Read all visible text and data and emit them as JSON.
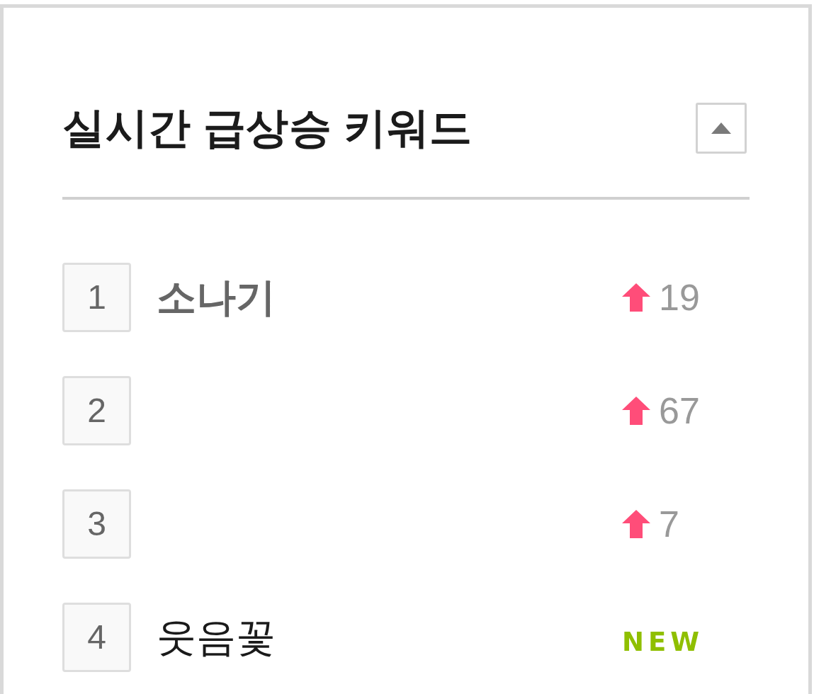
{
  "panel": {
    "title": "실시간 급상승 키워드",
    "expanded": true
  },
  "keywords": [
    {
      "rank": "1",
      "keyword": "소나기",
      "highlighted": true,
      "change": {
        "kind": "up",
        "value": "19"
      }
    },
    {
      "rank": "2",
      "change": {
        "kind": "up",
        "value": "67"
      }
    },
    {
      "rank": "3",
      "change": {
        "kind": "up",
        "value": "7"
      }
    },
    {
      "rank": "4",
      "keyword": "웃음꽃",
      "highlighted": false,
      "change": {
        "kind": "new",
        "label": "NEW"
      }
    }
  ]
}
